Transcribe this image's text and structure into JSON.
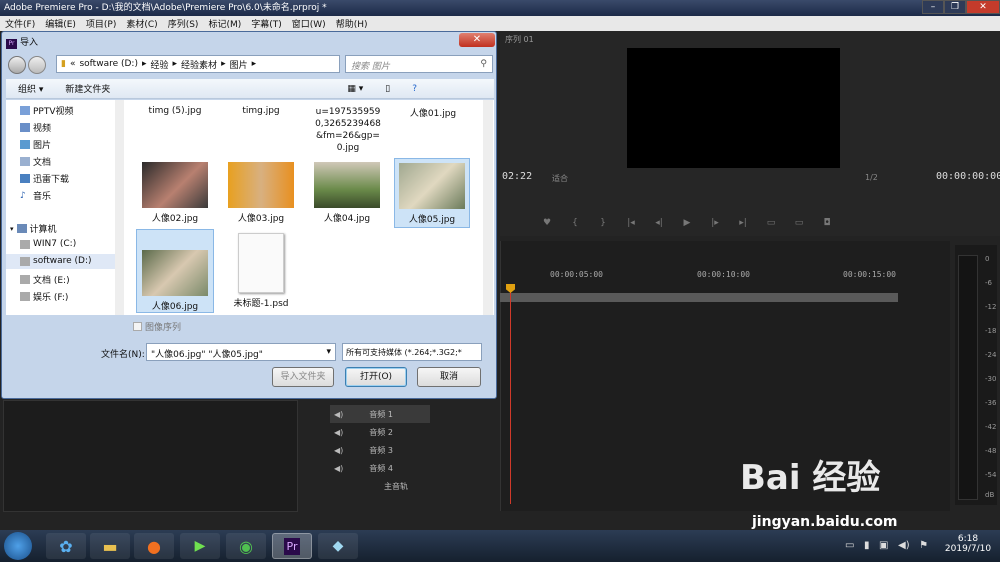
{
  "app": {
    "title": "Adobe Premiere Pro - D:\\我的文档\\Adobe\\Premiere Pro\\6.0\\未命名.prproj *",
    "menu": [
      "文件(F)",
      "编辑(E)",
      "项目(P)",
      "素材(C)",
      "序列(S)",
      "标记(M)",
      "字幕(T)",
      "窗口(W)",
      "帮助(H)"
    ],
    "window_controls": [
      "–",
      "❐",
      "✕"
    ]
  },
  "program_monitor": {
    "tab": "序列 01",
    "timecode_left": "02:22",
    "fit": "适合",
    "fraction": "1/2",
    "timecode_right": "00:00:00:00"
  },
  "timeline": {
    "ruler_ticks": [
      "00:00:05:00",
      "00:00:10:00",
      "00:00:15:00"
    ],
    "tracks": [
      "音频 1",
      "音频 2",
      "音频 3",
      "音频 4",
      "主音轨"
    ]
  },
  "meter": {
    "db_labels": [
      "0",
      "-6",
      "-12",
      "-18",
      "-24",
      "-30",
      "-36",
      "-42",
      "-48",
      "-54",
      "dB"
    ]
  },
  "dialog": {
    "title": "导入",
    "address": {
      "part1": "«",
      "part2": "software (D:)",
      "part3": "经验",
      "part4": "经验素材",
      "part5": "图片"
    },
    "search_placeholder": "搜索 图片",
    "toolbar": {
      "organize": "组织 ▾",
      "new_folder": "新建文件夹"
    },
    "nav_items": [
      "PPTV视频",
      "视频",
      "图片",
      "文档",
      "迅雷下载",
      "音乐",
      "计算机",
      "WIN7 (C:)",
      "software (D:)",
      "文档 (E:)",
      "娱乐 (F:)"
    ],
    "files_top": [
      "timg (5).jpg",
      "timg.jpg",
      "u=1975359590,3265239468&fm=26&gp=0.jpg",
      "人像01.jpg"
    ],
    "files": [
      "人像02.jpg",
      "人像03.jpg",
      "人像04.jpg",
      "人像05.jpg",
      "人像06.jpg",
      "未标题-1.psd"
    ],
    "image_sequence": "图像序列",
    "filename_label": "文件名(N):",
    "filename_value": "\"人像06.jpg\" \"人像05.jpg\"",
    "filetype_value": "所有可支持媒体 (*.264;*.3G2;*",
    "buttons": {
      "import_folder": "导入文件夹",
      "open": "打开(O)",
      "cancel": "取消"
    }
  },
  "taskbar": {
    "time": "6:18",
    "date": "2019/7/10"
  },
  "watermark": {
    "logo": "Bai 经验",
    "url": "jingyan.baidu.com"
  }
}
